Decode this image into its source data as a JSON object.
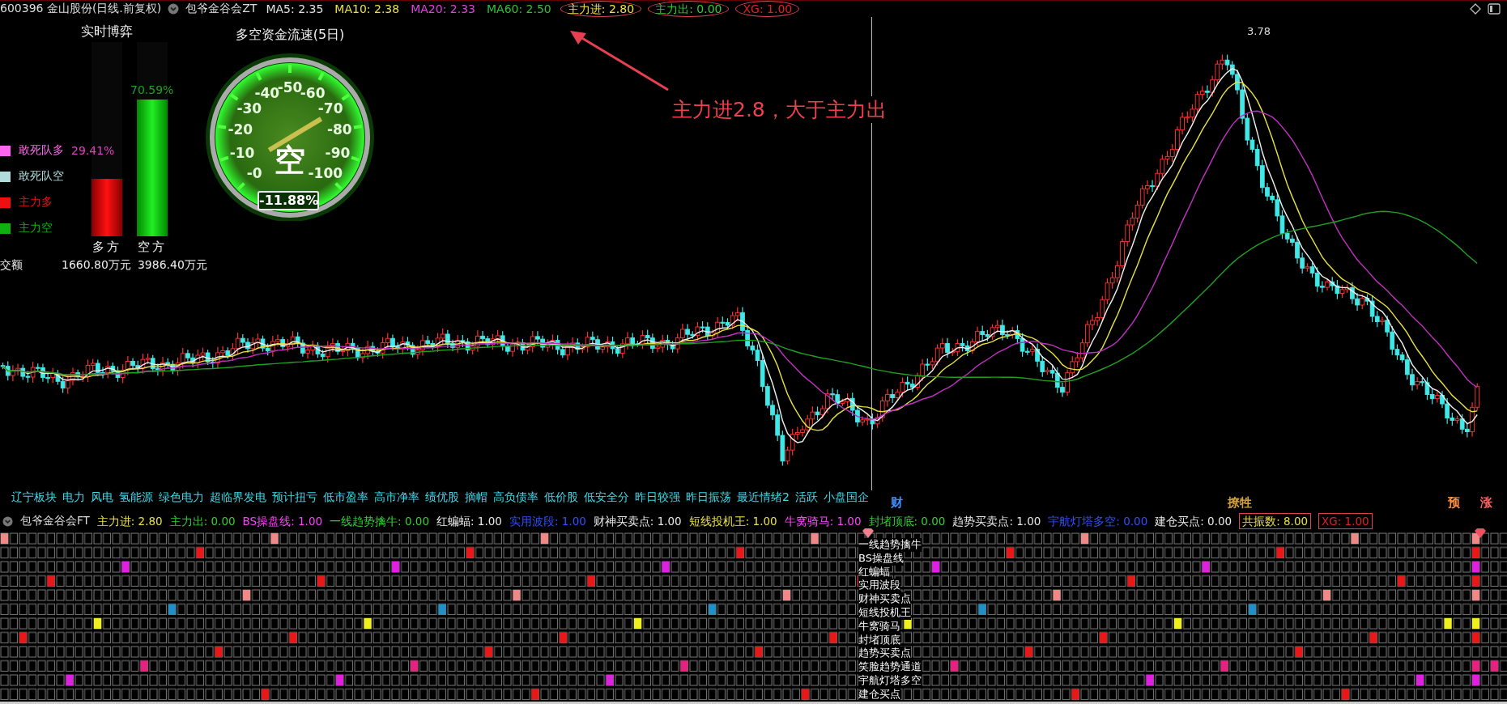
{
  "header": {
    "symbol": "600396 金山股份(日线.前复权)",
    "indicator": "包爷金谷会ZT",
    "values": [
      {
        "label": "MA5: 2.35",
        "color": "#e0e0e0",
        "circled": false
      },
      {
        "label": "MA10: 2.38",
        "color": "#e8e040",
        "circled": false
      },
      {
        "label": "MA20: 2.33",
        "color": "#e040e0",
        "circled": false
      },
      {
        "label": "MA60: 2.50",
        "color": "#30c030",
        "circled": false
      },
      {
        "label": "主力进: 2.80",
        "color": "#f0e040",
        "circled": true
      },
      {
        "label": "主力出: 0.00",
        "color": "#30d030",
        "circled": true
      },
      {
        "label": "XG: 1.00",
        "color": "#e02020",
        "circled": true
      }
    ]
  },
  "realtime_panel": {
    "title": "实时博弈",
    "legend": [
      {
        "label": "敢死队多",
        "color": "#ff66ee"
      },
      {
        "label": "敢死队空",
        "color": "#b0dcdc"
      },
      {
        "label": "主力多",
        "color": "#ee1010"
      },
      {
        "label": "主力空",
        "color": "#10b010"
      }
    ],
    "long_pct": "29.41%",
    "short_pct": "70.59%",
    "bars": [
      {
        "kind": "long",
        "label": "多方",
        "level": 0.2941
      },
      {
        "kind": "short",
        "label": "空方",
        "level": 0.7059
      }
    ],
    "amount_label": "交额",
    "amounts": [
      "1660.80万元",
      "3986.40万元"
    ]
  },
  "gauge": {
    "title": "多空资金流速(5日)",
    "ticks": [
      "-0",
      "-10",
      "-20",
      "-30",
      "-40",
      "-50",
      "-60",
      "-70",
      "-80",
      "-90",
      "-100"
    ],
    "center_label": "空",
    "reading": "-11.88%"
  },
  "annotation": "主力进2.8，大于主力出",
  "price_label": "3.78",
  "tags": [
    "辽宁板块",
    "电力",
    "风电",
    "氢能源",
    "绿色电力",
    "超临界发电",
    "预计扭亏",
    "低市盈率",
    "高市净率",
    "绩优股",
    "摘帽",
    "高负债率",
    "低价股",
    "低安全分",
    "昨日较强",
    "昨日振荡",
    "最近情绪2",
    "活跃",
    "小盘国企"
  ],
  "markers": [
    {
      "label": "财",
      "color": "#4090ff"
    },
    {
      "label": "撩牲",
      "color": "#d0a040"
    },
    {
      "label": "预",
      "color": "#ff9040"
    },
    {
      "label": "涨",
      "color": "#ff6060"
    }
  ],
  "indicator_header": {
    "indicator": "包爷金谷会FT",
    "values": [
      {
        "label": "主力进: 2.80",
        "color": "#e8e040",
        "circled": false
      },
      {
        "label": "主力出: 0.00",
        "color": "#30d030",
        "circled": false
      },
      {
        "label": "BS操盘线: 1.00",
        "color": "#ff40ff",
        "circled": false
      },
      {
        "label": "一线趋势擒牛: 0.00",
        "color": "#30d030",
        "circled": false
      },
      {
        "label": "红蝙蝠: 1.00",
        "color": "#e8e8e8",
        "circled": false
      },
      {
        "label": "实用波段: 1.00",
        "color": "#3050ff",
        "circled": false
      },
      {
        "label": "财神买卖点: 1.00",
        "color": "#e8e8e8",
        "circled": false
      },
      {
        "label": "短线投机王: 1.00",
        "color": "#e8e040",
        "circled": false
      },
      {
        "label": "牛窝骑马: 1.00",
        "color": "#ff40ff",
        "circled": false
      },
      {
        "label": "封堵顶底: 0.00",
        "color": "#30d030",
        "circled": false
      },
      {
        "label": "趋势买卖点: 1.00",
        "color": "#e8e8e8",
        "circled": false
      },
      {
        "label": "宇航灯塔多空: 0.00",
        "color": "#3050ff",
        "circled": false
      },
      {
        "label": "建仓买点: 0.00",
        "color": "#e8e8e8",
        "circled": false
      },
      {
        "label": "共振数: 8.00",
        "color": "#e8e040",
        "circled": true
      },
      {
        "label": "XG: 1.00",
        "color": "#e02020",
        "circled": true
      }
    ]
  },
  "signals": [
    {
      "label": "一线趋势擒牛",
      "color": "#f08888"
    },
    {
      "label": "BS操盘线",
      "color": "#e81818"
    },
    {
      "label": "红蝙蝠",
      "color": "#e020e0"
    },
    {
      "label": "实用波段",
      "color": "#e81818"
    },
    {
      "label": "财神买卖点",
      "color": "#f08888"
    },
    {
      "label": "短线投机王",
      "color": "#2090c8"
    },
    {
      "label": "牛窝骑马",
      "color": "#f0f020"
    },
    {
      "label": "封堵顶底",
      "color": "#e81818"
    },
    {
      "label": "趋势买卖点",
      "color": "#e81818"
    },
    {
      "label": "笑脸趋势通道",
      "color": "#e82080"
    },
    {
      "label": "宇航灯塔多空",
      "color": "#e020e0"
    },
    {
      "label": "建仓买点",
      "color": "#e81818"
    }
  ]
}
